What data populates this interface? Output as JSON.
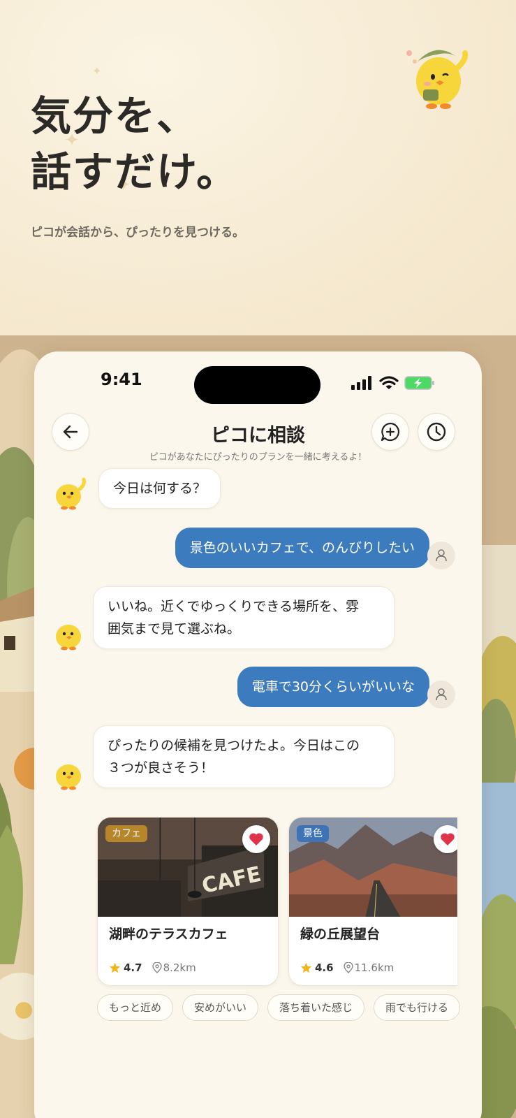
{
  "hero": {
    "title_line1": "気分を、",
    "title_line2": "話すだけ。",
    "subtitle": "ピコが会話から、ぴったりを見つける。"
  },
  "status_bar": {
    "time": "9:41"
  },
  "header": {
    "title": "ピコに相談",
    "subtitle": "ピコがあなたにぴったりのプランを一緒に考えるよ！",
    "back_icon": "arrow-left-icon",
    "new_chat_icon": "chat-plus-icon",
    "history_icon": "clock-icon"
  },
  "messages": [
    {
      "role": "bot",
      "text": "今日は何する？"
    },
    {
      "role": "user",
      "text": "景色のいいカフェで、のんびりしたい"
    },
    {
      "role": "bot",
      "line1": "いいね。近くでゆっくりできる場所を、雰",
      "line2": "囲気まで見て選ぶね。"
    },
    {
      "role": "user",
      "text": "電車で30分くらいがいいな"
    },
    {
      "role": "bot",
      "line1": "ぴったりの候補を見つけたよ。今日はこの",
      "line2": "３つが良さそう！"
    }
  ],
  "cards": [
    {
      "tag": "カフェ",
      "image_text": "CAFE",
      "name": "湖畔のテラスカフェ",
      "rating": "4.7",
      "distance": "8.2km"
    },
    {
      "tag": "景色",
      "name": "緑の丘展望台",
      "rating": "4.6",
      "distance": "11.6km"
    }
  ],
  "chips": [
    "もっと近め",
    "安めがいい",
    "落ち着いた感じ",
    "雨でも行ける"
  ],
  "colors": {
    "accent_blue": "#3d7bbf",
    "tag_cafe": "#b8862a",
    "tag_scenery": "#3f73b8",
    "heart": "#e0344a",
    "star": "#f0b41c"
  }
}
